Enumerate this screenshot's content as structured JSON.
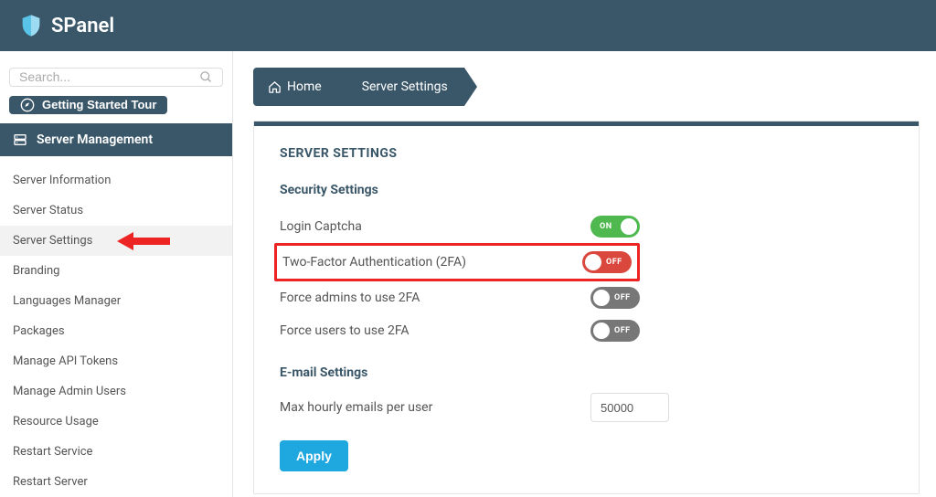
{
  "brand": "SPanel",
  "search": {
    "placeholder": "Search..."
  },
  "tour": {
    "label": "Getting Started Tour"
  },
  "sidebar": {
    "section": "Server Management",
    "items": [
      {
        "label": "Server Information"
      },
      {
        "label": "Server Status"
      },
      {
        "label": "Server Settings",
        "active": true
      },
      {
        "label": "Branding"
      },
      {
        "label": "Languages Manager"
      },
      {
        "label": "Packages"
      },
      {
        "label": "Manage API Tokens"
      },
      {
        "label": "Manage Admin Users"
      },
      {
        "label": "Resource Usage"
      },
      {
        "label": "Restart Service"
      },
      {
        "label": "Restart Server"
      }
    ]
  },
  "breadcrumb": {
    "home": "Home",
    "current": "Server Settings"
  },
  "panel": {
    "title": "SERVER SETTINGS",
    "security_hdr": "Security Settings",
    "email_hdr": "E-mail Settings",
    "settings": {
      "login_captcha": {
        "label": "Login Captcha",
        "state": "ON"
      },
      "two_fa": {
        "label": "Two-Factor Authentication (2FA)",
        "state": "OFF"
      },
      "force_admin_2fa": {
        "label": "Force admins to use 2FA",
        "state": "OFF"
      },
      "force_user_2fa": {
        "label": "Force users to use 2FA",
        "state": "OFF"
      }
    },
    "max_hourly": {
      "label": "Max hourly emails per user",
      "value": "50000"
    },
    "apply": "Apply"
  }
}
